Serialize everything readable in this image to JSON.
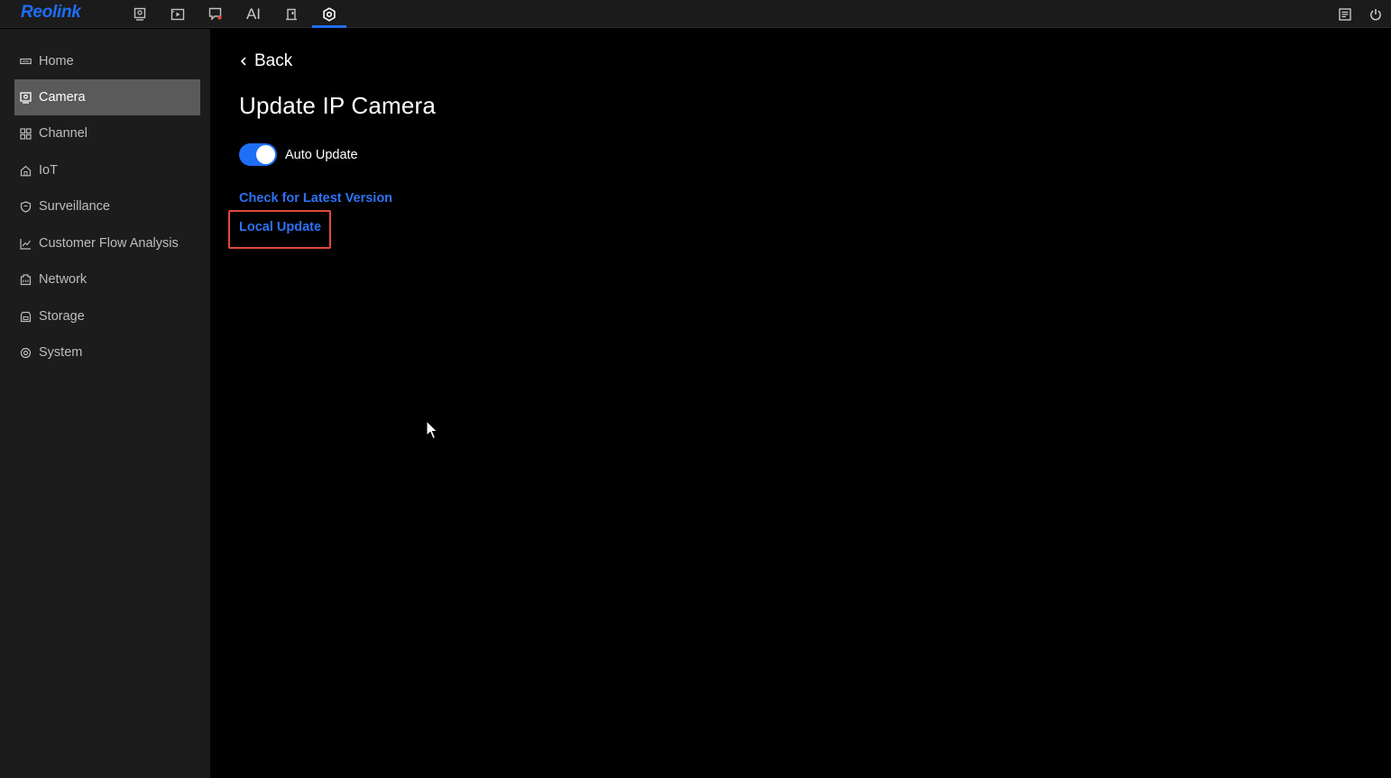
{
  "app": {
    "logo_text": "Reolink",
    "accent_color": "#1f6ef5"
  },
  "topnav": {
    "tabs": [
      {
        "name": "live-view-icon",
        "active": false
      },
      {
        "name": "playback-icon",
        "active": false
      },
      {
        "name": "alerts-icon",
        "active": false
      },
      {
        "name": "ai-tab",
        "label": "AI",
        "active": false
      },
      {
        "name": "devices-icon",
        "active": false
      },
      {
        "name": "settings-icon",
        "active": true
      }
    ],
    "right": [
      {
        "name": "notes-icon"
      },
      {
        "name": "power-icon"
      }
    ]
  },
  "sidebar": {
    "items": [
      {
        "label": "Home",
        "icon": "home-icon",
        "active": false
      },
      {
        "label": "Camera",
        "icon": "camera-icon",
        "active": true
      },
      {
        "label": "Channel",
        "icon": "channel-grid-icon",
        "active": false
      },
      {
        "label": "IoT",
        "icon": "iot-house-icon",
        "active": false
      },
      {
        "label": "Surveillance",
        "icon": "shield-icon",
        "active": false
      },
      {
        "label": "Customer Flow Analysis",
        "icon": "chart-line-icon",
        "active": false
      },
      {
        "label": "Network",
        "icon": "network-icon",
        "active": false
      },
      {
        "label": "Storage",
        "icon": "storage-icon",
        "active": false
      },
      {
        "label": "System",
        "icon": "system-gear-icon",
        "active": false
      }
    ]
  },
  "main": {
    "back_label": "Back",
    "title": "Update IP Camera",
    "auto_update": {
      "label": "Auto Update",
      "enabled": true
    },
    "check_latest_label": "Check for Latest Version",
    "local_update_label": "Local Update",
    "highlight_color": "#e0493d"
  }
}
